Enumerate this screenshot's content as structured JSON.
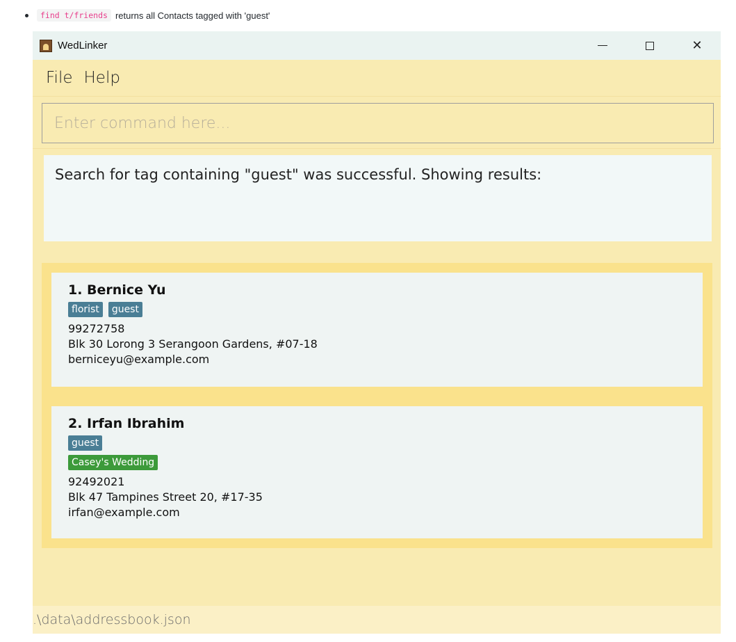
{
  "caption": {
    "code": "find t/friends",
    "text": "returns all Contacts tagged with 'guest'"
  },
  "window": {
    "title": "WedLinker",
    "controls": {
      "minimize": "minimize",
      "maximize": "maximize",
      "close": "✕"
    }
  },
  "menu": {
    "items": [
      "File",
      "Help"
    ]
  },
  "command": {
    "placeholder": "Enter command here..."
  },
  "result": {
    "text": "Search for tag containing \"guest\" was successful.  Showing results:"
  },
  "contacts": [
    {
      "name": "1. Bernice Yu",
      "tags": [
        "florist",
        "guest"
      ],
      "wedding_tags": [],
      "phone": "99272758",
      "address": "Blk 30 Lorong 3 Serangoon Gardens, #07-18",
      "email": "berniceyu@example.com"
    },
    {
      "name": "2. Irfan Ibrahim",
      "tags": [
        "guest"
      ],
      "wedding_tags": [
        "Casey's Wedding"
      ],
      "phone": "92492021",
      "address": "Blk 47 Tampines Street 20, #17-35",
      "email": "irfan@example.com"
    }
  ],
  "status": {
    "path": ".\\data\\addressbook.json"
  },
  "colors": {
    "window_bg": "#f9ebb2",
    "list_bg": "#fae28c",
    "card_bg": "#eff4f3",
    "tag": "#4a7e95",
    "wedding_tag": "#3c9a3a"
  }
}
